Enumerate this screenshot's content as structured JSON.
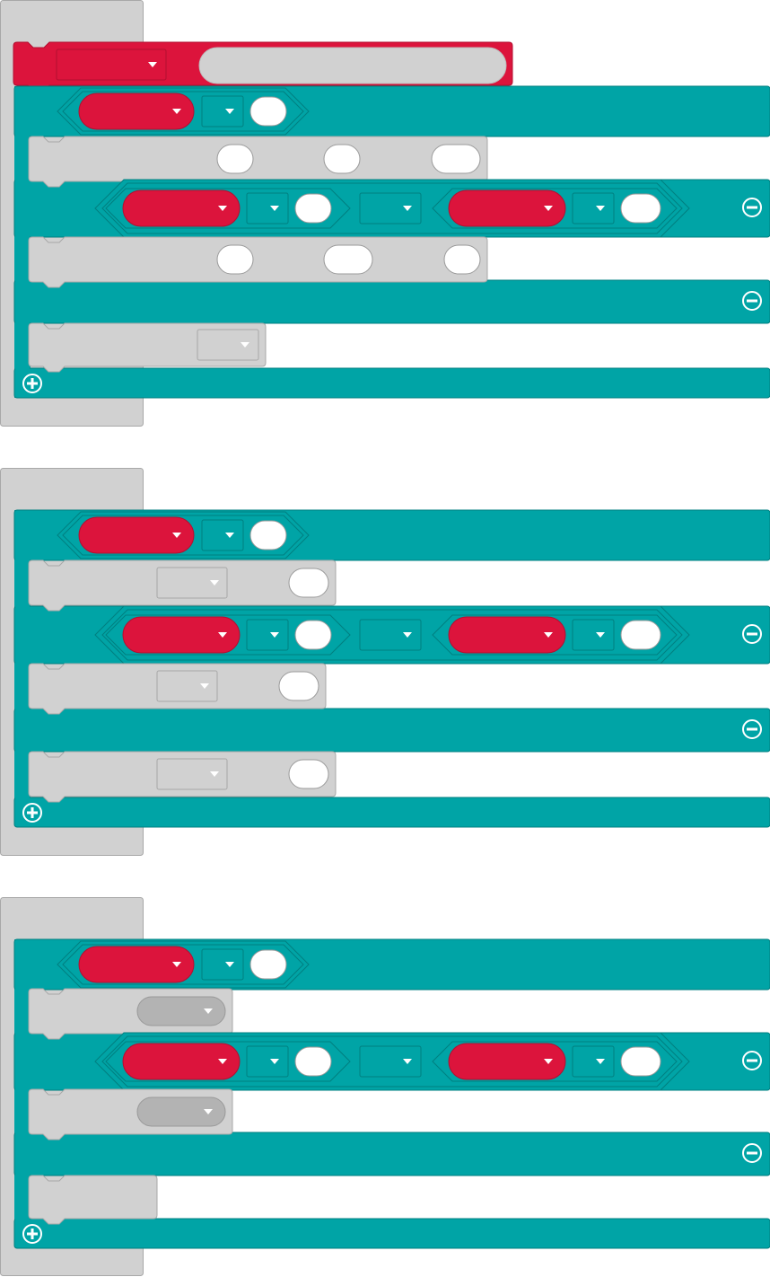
{
  "colors": {
    "teal": "#00A4A6",
    "teal_dark": "#007F80",
    "red": "#DC143C",
    "red_dark": "#B20F30",
    "gray_block": "#D1D1D1",
    "gray_border": "#A8A8A8",
    "white": "#FFFFFF",
    "pill_gray": "#B3B3B3"
  },
  "icons": {
    "dropdown": "caret-down-icon",
    "remove": "minus-circle-icon",
    "add": "plus-circle-icon"
  },
  "groups": [
    {
      "name": "group-1",
      "has_header_block": true,
      "rows": [
        {
          "kind": "condition-simple"
        },
        {
          "kind": "statement",
          "variant": "three-slots"
        },
        {
          "kind": "condition-compound",
          "removable": true
        },
        {
          "kind": "statement",
          "variant": "three-slots-b"
        },
        {
          "kind": "else",
          "removable": true
        },
        {
          "kind": "statement",
          "variant": "dropdown-only"
        }
      ],
      "footer_add": true
    },
    {
      "name": "group-2",
      "has_header_block": false,
      "rows": [
        {
          "kind": "condition-simple"
        },
        {
          "kind": "statement",
          "variant": "dropdown-slot"
        },
        {
          "kind": "condition-compound",
          "removable": true
        },
        {
          "kind": "statement",
          "variant": "dropdown-slot-short"
        },
        {
          "kind": "else",
          "removable": true
        },
        {
          "kind": "statement",
          "variant": "dropdown-slot"
        }
      ],
      "footer_add": true
    },
    {
      "name": "group-3",
      "has_header_block": false,
      "rows": [
        {
          "kind": "condition-simple"
        },
        {
          "kind": "statement",
          "variant": "pill-dropdown"
        },
        {
          "kind": "condition-compound",
          "removable": true
        },
        {
          "kind": "statement",
          "variant": "pill-dropdown"
        },
        {
          "kind": "else",
          "removable": true
        },
        {
          "kind": "statement",
          "variant": "empty"
        }
      ],
      "footer_add": true
    }
  ]
}
